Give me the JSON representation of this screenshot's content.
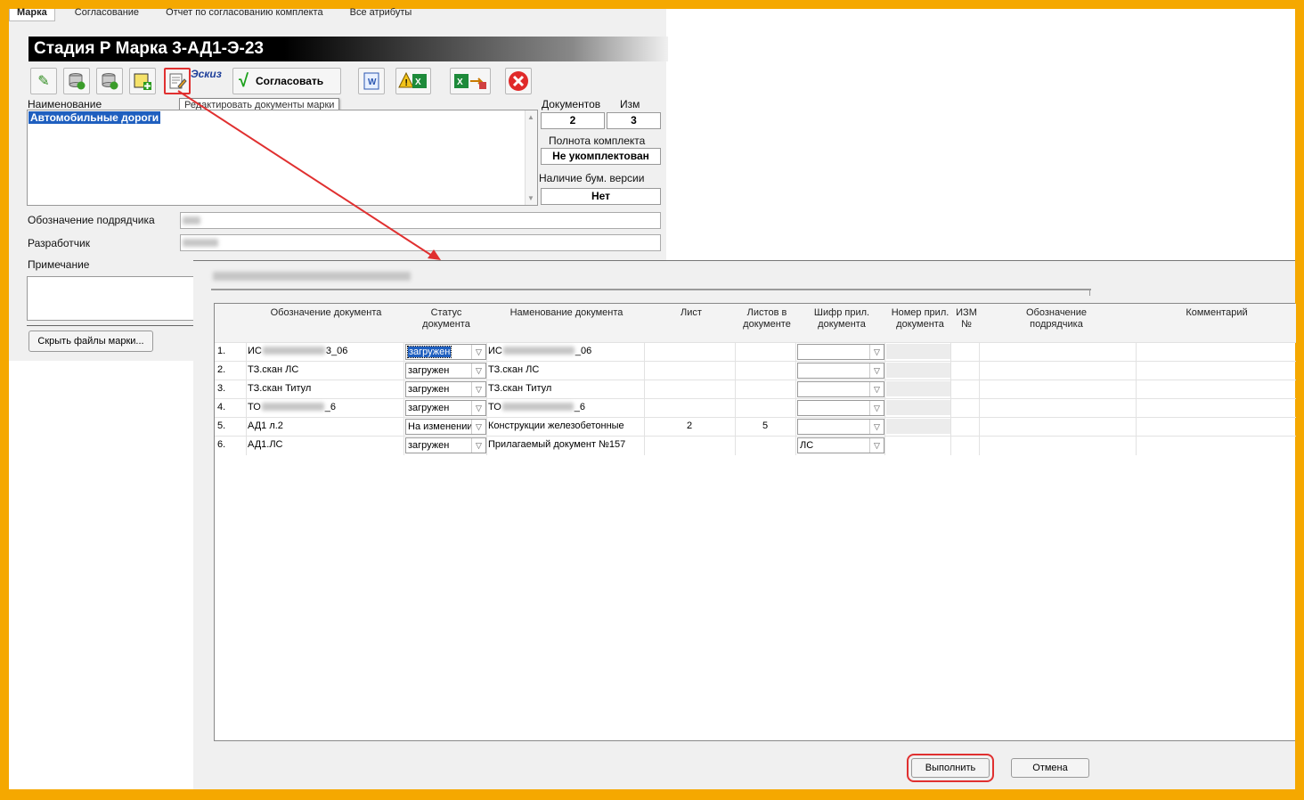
{
  "tabs": [
    "Марка",
    "Согласование",
    "Отчет по согласованию комплекта",
    "Все атрибуты"
  ],
  "header": {
    "title": "Стадия Р Марка 3-АД1-Э-23"
  },
  "toolbar": {
    "eskiz": "Эскиз",
    "agree_label": "Согласовать",
    "icons": [
      "pencil-icon",
      "db-refresh-icon",
      "db-add-icon",
      "note-add-icon",
      "edit-docs-icon",
      "word-icon",
      "excel-warning-icon",
      "excel-export-icon",
      "close-icon"
    ],
    "tooltip": "Редактировать документы марки"
  },
  "form": {
    "name_label": "Наименование",
    "name_value": "Автомобильные дороги",
    "docs_label": "Документов",
    "docs_value": "2",
    "izm_label": "Изм",
    "izm_value": "3",
    "completeness_label": "Полнота комплекта",
    "completeness_value": "Не укомплектован",
    "paper_label": "Наличие бум. версии",
    "paper_value": "Нет",
    "contractor_label": "Обозначение подрядчика",
    "developer_label": "Разработчик",
    "note_label": "Примечание",
    "hide_files_btn": "Скрыть файлы марки..."
  },
  "dialog": {
    "columns": [
      "Обозначение документа",
      "Статус документа",
      "Наменование документа",
      "Лист",
      "Листов в документе",
      "Шифр прил. документа",
      "Номер прил. документа",
      "ИЗМ №",
      "Обозначение подрядчика",
      "Комментарий"
    ],
    "rows": [
      {
        "n": "1.",
        "code": "ИС",
        "code_tail": "3_06",
        "status": "загружен",
        "name": "ИС",
        "name_tail": "_06",
        "sheet": "",
        "sheets": "",
        "cipher": ""
      },
      {
        "n": "2.",
        "code": "ТЗ.скан ЛС",
        "code_tail": "",
        "status": "загружен",
        "name": "ТЗ.скан ЛС",
        "name_tail": "",
        "sheet": "",
        "sheets": "",
        "cipher": ""
      },
      {
        "n": "3.",
        "code": "ТЗ.скан Титул",
        "code_tail": "",
        "status": "загружен",
        "name": "ТЗ.скан Титул",
        "name_tail": "",
        "sheet": "",
        "sheets": "",
        "cipher": ""
      },
      {
        "n": "4.",
        "code": "ТО",
        "code_tail": "_6",
        "status": "загружен",
        "name": "ТО",
        "name_tail": "_6",
        "sheet": "",
        "sheets": "",
        "cipher": ""
      },
      {
        "n": "5.",
        "code": "АД1 л.2",
        "code_tail": "",
        "status": "На изменении",
        "name": "Конструкции железобетонные",
        "name_tail": "",
        "sheet": "2",
        "sheets": "5",
        "cipher": ""
      },
      {
        "n": "6.",
        "code": "АД1.ЛС",
        "code_tail": "",
        "status": "загружен",
        "name": "Прилагаемый документ №157",
        "name_tail": "",
        "sheet": "",
        "sheets": "",
        "cipher": "ЛС"
      }
    ],
    "ok_label": "Выполнить",
    "cancel_label": "Отмена"
  },
  "colors": {
    "frame": "#f5a800",
    "highlight": "#e03030",
    "selection": "#1f5fbf"
  }
}
